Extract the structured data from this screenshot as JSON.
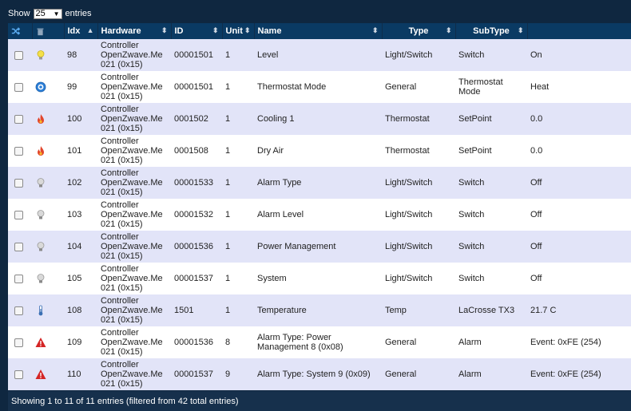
{
  "top": {
    "show_label": "Show",
    "page_size": "25",
    "entries_label": "entries"
  },
  "columns": {
    "idx": "Idx",
    "hardware": "Hardware",
    "id": "ID",
    "unit": "Unit",
    "name": "Name",
    "type": "Type",
    "subtype": "SubType"
  },
  "rows": [
    {
      "icon": "bulb-on-icon",
      "idx": "98",
      "hw1": "Controller",
      "hw2": "OpenZwave.Me",
      "hw3": "021 (0x15)",
      "id": "00001501",
      "unit": "1",
      "name": "Level",
      "type": "Light/Switch",
      "subtype": "Switch",
      "data": "On"
    },
    {
      "icon": "thermostat-mode-icon",
      "idx": "99",
      "hw1": "Controller",
      "hw2": "OpenZwave.Me",
      "hw3": "021 (0x15)",
      "id": "00001501",
      "unit": "1",
      "name": "Thermostat Mode",
      "type": "General",
      "subtype": "Thermostat Mode",
      "data": "Heat"
    },
    {
      "icon": "flame-icon",
      "idx": "100",
      "hw1": "Controller",
      "hw2": "OpenZwave.Me",
      "hw3": "021 (0x15)",
      "id": "0001502",
      "unit": "1",
      "name": "Cooling 1",
      "type": "Thermostat",
      "subtype": "SetPoint",
      "data": "0.0"
    },
    {
      "icon": "flame-icon",
      "idx": "101",
      "hw1": "Controller",
      "hw2": "OpenZwave.Me",
      "hw3": "021 (0x15)",
      "id": "0001508",
      "unit": "1",
      "name": "Dry Air",
      "type": "Thermostat",
      "subtype": "SetPoint",
      "data": "0.0"
    },
    {
      "icon": "bulb-off-icon",
      "idx": "102",
      "hw1": "Controller",
      "hw2": "OpenZwave.Me",
      "hw3": "021 (0x15)",
      "id": "00001533",
      "unit": "1",
      "name": "Alarm Type",
      "type": "Light/Switch",
      "subtype": "Switch",
      "data": "Off"
    },
    {
      "icon": "bulb-off-icon",
      "idx": "103",
      "hw1": "Controller",
      "hw2": "OpenZwave.Me",
      "hw3": "021 (0x15)",
      "id": "00001532",
      "unit": "1",
      "name": "Alarm Level",
      "type": "Light/Switch",
      "subtype": "Switch",
      "data": "Off"
    },
    {
      "icon": "bulb-off-icon",
      "idx": "104",
      "hw1": "Controller",
      "hw2": "OpenZwave.Me",
      "hw3": "021 (0x15)",
      "id": "00001536",
      "unit": "1",
      "name": "Power Management",
      "type": "Light/Switch",
      "subtype": "Switch",
      "data": "Off"
    },
    {
      "icon": "bulb-off-icon",
      "idx": "105",
      "hw1": "Controller",
      "hw2": "OpenZwave.Me",
      "hw3": "021 (0x15)",
      "id": "00001537",
      "unit": "1",
      "name": "System",
      "type": "Light/Switch",
      "subtype": "Switch",
      "data": "Off"
    },
    {
      "icon": "thermometer-icon",
      "idx": "108",
      "hw1": "Controller",
      "hw2": "OpenZwave.Me",
      "hw3": "021 (0x15)",
      "id": "1501",
      "unit": "1",
      "name": "Temperature",
      "type": "Temp",
      "subtype": "LaCrosse TX3",
      "data": "21.7 C"
    },
    {
      "icon": "alert-icon",
      "idx": "109",
      "hw1": "Controller",
      "hw2": "OpenZwave.Me",
      "hw3": "021 (0x15)",
      "id": "00001536",
      "unit": "8",
      "name": "Alarm Type: Power Management 8 (0x08)",
      "type": "General",
      "subtype": "Alarm",
      "data": "Event: 0xFE (254)"
    },
    {
      "icon": "alert-icon",
      "idx": "110",
      "hw1": "Controller",
      "hw2": "OpenZwave.Me",
      "hw3": "021 (0x15)",
      "id": "00001537",
      "unit": "9",
      "name": "Alarm Type: System 9 (0x09)",
      "type": "General",
      "subtype": "Alarm",
      "data": "Event: 0xFE (254)"
    }
  ],
  "footer": {
    "info": "Showing 1 to 11 of 11 entries (filtered from 42 total entries)"
  },
  "colors": {
    "header_bg": "#0a3a63",
    "odd_row": "#e2e4f8",
    "page_bg": "#0f2740"
  }
}
